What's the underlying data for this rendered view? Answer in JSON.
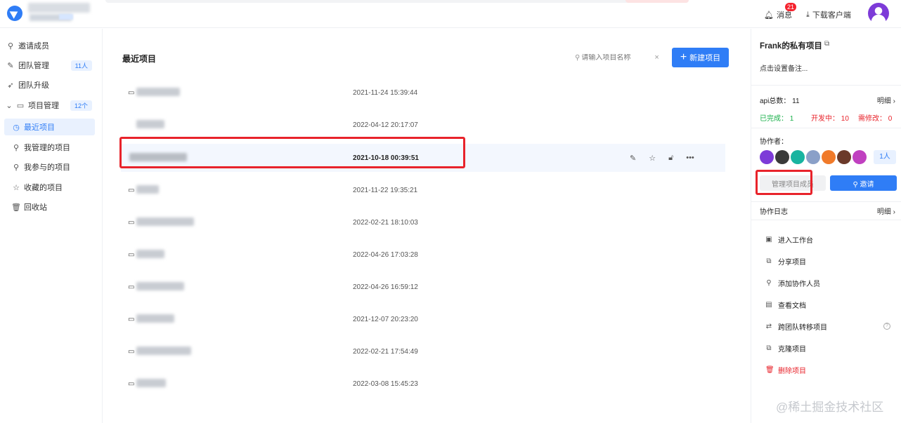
{
  "header": {
    "messages_label": "消息",
    "messages_badge": "21",
    "download_label": "下载客户端"
  },
  "sidebar": {
    "items": [
      {
        "label": "邀请成员",
        "icon": "user-icon"
      },
      {
        "label": "团队管理",
        "icon": "wrench-icon",
        "count": "11人"
      },
      {
        "label": "团队升级",
        "icon": "rocket-icon"
      },
      {
        "label": "项目管理",
        "icon": "folder-icon",
        "count": "12个"
      },
      {
        "label": "最近项目",
        "icon": "clock-icon"
      },
      {
        "label": "我管理的项目",
        "icon": "user-icon"
      },
      {
        "label": "我参与的项目",
        "icon": "user-icon"
      },
      {
        "label": "收藏的项目",
        "icon": "star-icon"
      },
      {
        "label": "回收站",
        "icon": "trash-icon"
      }
    ]
  },
  "main": {
    "title": "最近项目",
    "search_placeholder": "请输入项目名称",
    "new_button": "新建项目",
    "rows": [
      {
        "time": "2021-11-24 15:39:44"
      },
      {
        "time": "2022-04-12 20:17:07"
      },
      {
        "time": "2021-10-18 00:39:51"
      },
      {
        "time": "2021-11-22 19:35:21"
      },
      {
        "time": "2022-02-21 18:10:03"
      },
      {
        "time": "2022-04-26 17:03:28"
      },
      {
        "time": "2022-04-26 16:59:12"
      },
      {
        "time": "2021-12-07 20:23:20"
      },
      {
        "time": "2022-02-21 17:54:49"
      },
      {
        "time": "2022-03-08 15:45:23"
      }
    ]
  },
  "right_panel": {
    "title": "Frank的私有项目",
    "note": "点击设置备注...",
    "api_total_label": "api总数：",
    "api_total": "11",
    "detail_label": "明细",
    "done_label": "已完成：",
    "done": "1",
    "developing_label": "开发中：",
    "developing": "10",
    "needs_fix_label": "需修改：",
    "needs_fix": "0",
    "collaborators_label": "协作者：",
    "collaborator_count": "1人",
    "manage_button": "管理项目成员",
    "invite_button": "邀请",
    "log_label": "协作日志",
    "log_detail_label": "明细",
    "actions": [
      {
        "label": "进入工作台",
        "icon": "workbench-icon"
      },
      {
        "label": "分享项目",
        "icon": "share-icon"
      },
      {
        "label": "添加协作人员",
        "icon": "user-icon"
      },
      {
        "label": "查看文档",
        "icon": "document-icon"
      },
      {
        "label": "跨团队转移项目",
        "icon": "transfer-icon"
      },
      {
        "label": "克隆项目",
        "icon": "copy-icon"
      },
      {
        "label": "删除项目",
        "icon": "trash-icon"
      }
    ]
  },
  "watermark": "@稀土掘金技术社区",
  "colors": {
    "accent": "#2f7df6",
    "danger": "#e8232b",
    "success": "#19b04a",
    "highlight_box": "#e8232b"
  }
}
